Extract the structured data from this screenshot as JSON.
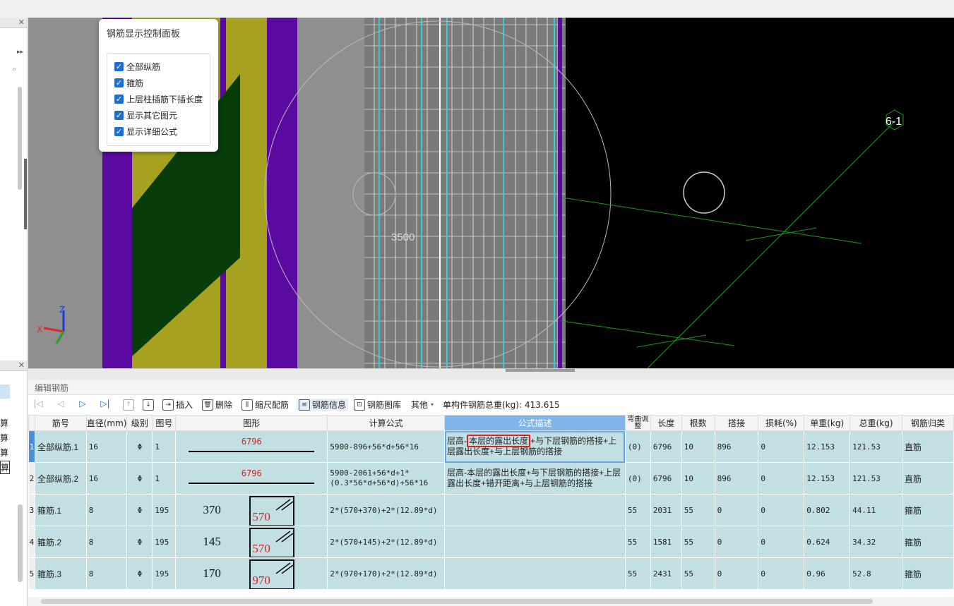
{
  "control_panel": {
    "title": "钢筋显示控制面板",
    "options": [
      "全部纵筋",
      "箍筋",
      "上层柱插筋下插长度",
      "显示其它图元",
      "显示详细公式"
    ]
  },
  "viewport": {
    "dimension_label": "3500",
    "axis_label": "6-1",
    "axis_x": "X",
    "axis_z": "Z"
  },
  "left_pane": {
    "items": [
      "算",
      "算",
      "算",
      "算"
    ]
  },
  "editor": {
    "title": "编辑钢筋",
    "toolbar": {
      "insert": "插入",
      "delete": "删除",
      "scale_rebar": "缩尺配筋",
      "rebar_info": "钢筋信息",
      "rebar_library": "钢筋图库",
      "other": "其他",
      "total_weight_label": "单构件钢筋总重(kg):",
      "total_weight_value": "413.615"
    },
    "columns": [
      "筋号",
      "直径(mm)",
      "级别",
      "图号",
      "图形",
      "计算公式",
      "公式描述",
      "弯曲调整",
      "长度",
      "根数",
      "搭接",
      "损耗(%)",
      "单重(kg)",
      "总重(kg)",
      "钢筋归类"
    ],
    "rows": [
      {
        "num": "1",
        "name": "全部纵筋.1",
        "dia": "16",
        "grade": "Φ",
        "fig": "1",
        "shape_value": "6796",
        "formula": "5900-896+56*d+56*16",
        "desc_pre": "层高-",
        "desc_hl": "本层的露出长度",
        "desc_post": "+与下层钢筋的搭接+上层露出长度+与上层钢筋的搭接",
        "bend": "(0)",
        "length": "6796",
        "count": "10",
        "lap": "896",
        "loss": "0",
        "unit_w": "12.153",
        "total_w": "121.53",
        "category": "直筋"
      },
      {
        "num": "2",
        "name": "全部纵筋.2",
        "dia": "16",
        "grade": "Φ",
        "fig": "1",
        "shape_value": "6796",
        "formula": "5900-2061+56*d+1*(0.3*56*d+56*d)+56*16",
        "desc": "层高-本层的露出长度+与下层钢筋的搭接+上层露出长度+错开距离+与上层钢筋的搭接",
        "bend": "(0)",
        "length": "6796",
        "count": "10",
        "lap": "896",
        "loss": "0",
        "unit_w": "12.153",
        "total_w": "121.53",
        "category": "直筋"
      },
      {
        "num": "3",
        "name": "箍筋.1",
        "dia": "8",
        "grade": "Φ",
        "fig": "195",
        "shape_a": "370",
        "shape_b": "570",
        "formula": "2*(570+370)+2*(12.89*d)",
        "desc": "",
        "bend": "55",
        "length": "2031",
        "count": "55",
        "lap": "0",
        "loss": "0",
        "unit_w": "0.802",
        "total_w": "44.11",
        "category": "箍筋"
      },
      {
        "num": "4",
        "name": "箍筋.2",
        "dia": "8",
        "grade": "Φ",
        "fig": "195",
        "shape_a": "145",
        "shape_b": "570",
        "formula": "2*(570+145)+2*(12.89*d)",
        "desc": "",
        "bend": "55",
        "length": "1581",
        "count": "55",
        "lap": "0",
        "loss": "0",
        "unit_w": "0.624",
        "total_w": "34.32",
        "category": "箍筋"
      },
      {
        "num": "5",
        "name": "箍筋.3",
        "dia": "8",
        "grade": "Φ",
        "fig": "195",
        "shape_a": "170",
        "shape_b": "970",
        "formula": "2*(970+170)+2*(12.89*d)",
        "desc": "",
        "bend": "55",
        "length": "2431",
        "count": "55",
        "lap": "0",
        "loss": "0",
        "unit_w": "0.96",
        "total_w": "52.8",
        "category": "箍筋"
      }
    ]
  },
  "colors": {
    "row_bg": "#c2dfe3",
    "header_selected": "#7fb6ea",
    "highlight": "#e02020",
    "shape_text": "#e02020"
  }
}
